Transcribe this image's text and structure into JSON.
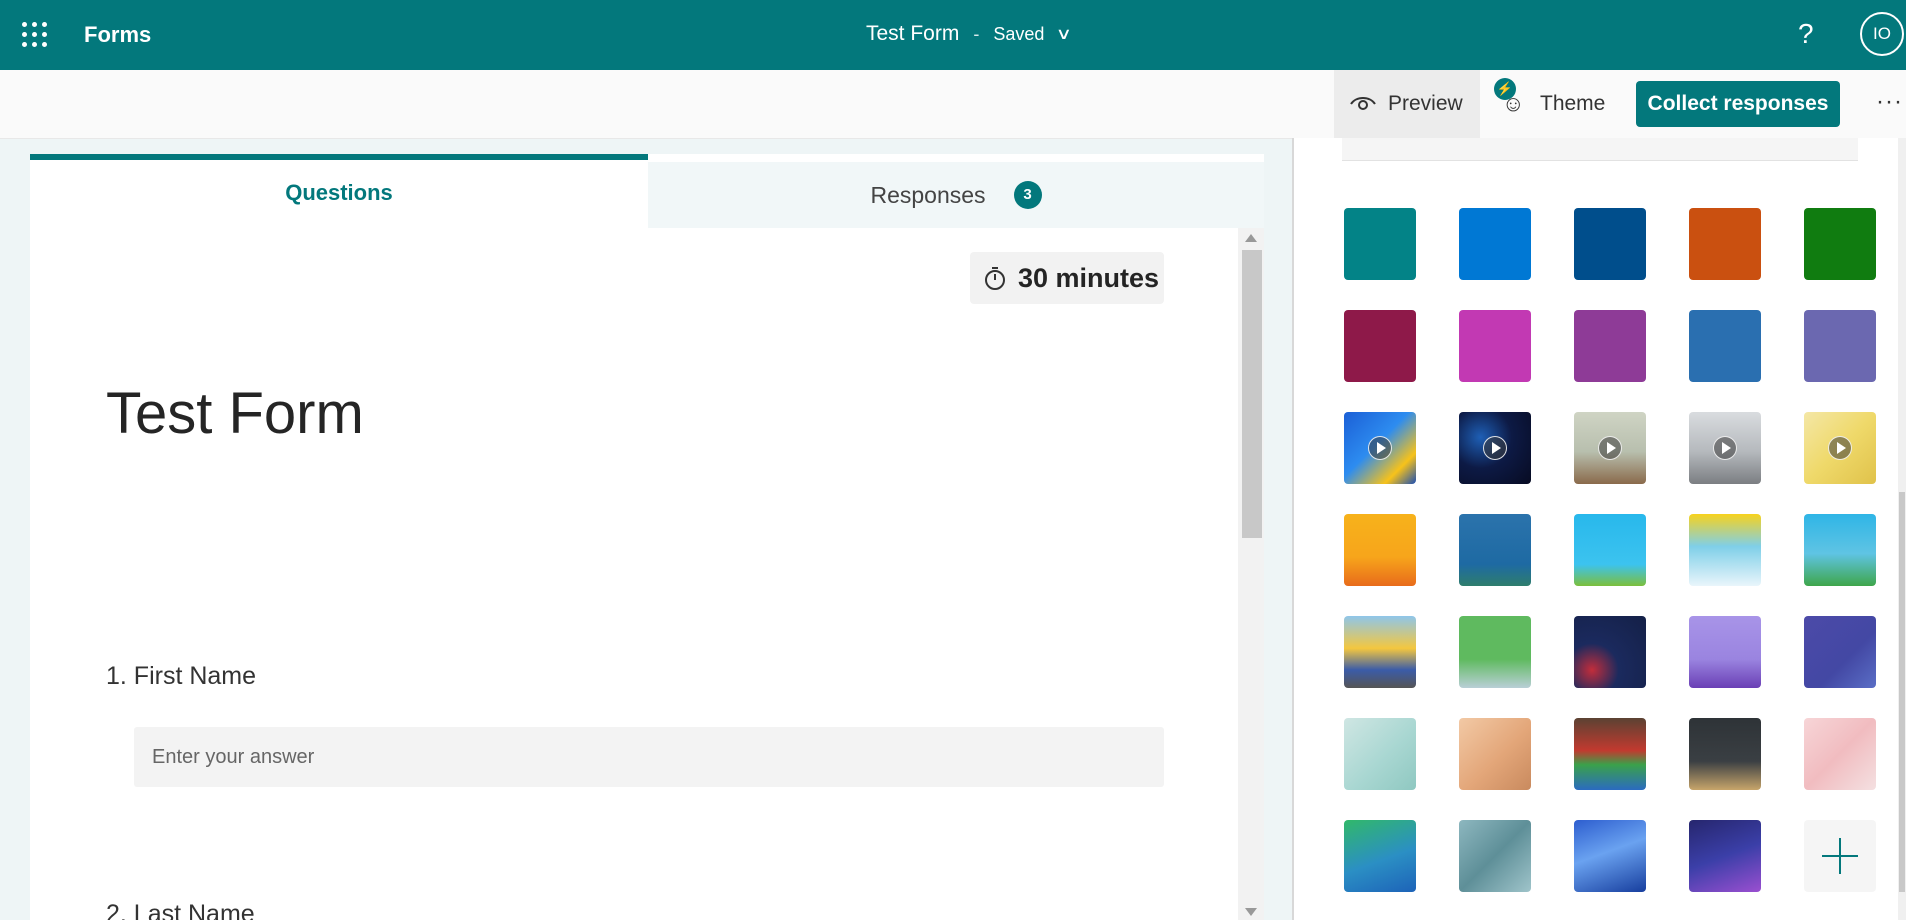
{
  "header": {
    "app_name": "Forms",
    "form_title": "Test Form",
    "separator": "-",
    "status": "Saved",
    "help_label": "?",
    "avatar_initials": "IO"
  },
  "commandbar": {
    "preview_label": "Preview",
    "theme_label": "Theme",
    "collect_label": "Collect responses",
    "more_label": "···"
  },
  "tabs": {
    "questions_label": "Questions",
    "responses_label": "Responses",
    "responses_count": "3"
  },
  "form": {
    "timer": "30 minutes",
    "title": "Test Form",
    "questions": [
      {
        "label": "1. First Name",
        "placeholder": "Enter your answer"
      },
      {
        "label": "2. Last Name"
      }
    ]
  },
  "theme_panel": {
    "swatches": [
      {
        "name": "teal",
        "style": "#038387"
      },
      {
        "name": "blue",
        "style": "#0078d4"
      },
      {
        "name": "dark-blue",
        "style": "#004e8c"
      },
      {
        "name": "orange",
        "style": "#ca5010"
      },
      {
        "name": "green",
        "style": "#107c10"
      },
      {
        "name": "burgundy",
        "style": "#8e1949"
      },
      {
        "name": "pink",
        "style": "#c239b3"
      },
      {
        "name": "purple",
        "style": "#8e3b97"
      },
      {
        "name": "steel-blue",
        "style": "#2a6fb0"
      },
      {
        "name": "lavender",
        "style": "#6b68b0"
      },
      {
        "name": "video-blue-shapes",
        "style": "linear-gradient(135deg,#1b5fd6 0%,#2d8cf0 45%,#f7c21a 78%,#1c4fb4 100%)",
        "video": true
      },
      {
        "name": "video-night-confetti",
        "style": "radial-gradient(circle at 30% 35%,#1e5fb5 0,#0d1a45 45%,#070b22 100%)",
        "video": true
      },
      {
        "name": "video-room",
        "style": "linear-gradient(180deg,#cfd4c4 0%,#b8bfae 55%,#8a6a4b 100%)",
        "video": true
      },
      {
        "name": "video-office",
        "style": "linear-gradient(180deg,#d9dcdf 0%,#b5b9bd 55%,#7b7e82 100%)",
        "video": true
      },
      {
        "name": "video-gold-shapes",
        "style": "linear-gradient(135deg,#f4e7a6 0%,#efd96a 50%,#e0c24a 100%)",
        "video": true
      },
      {
        "name": "yellow-orange-scene",
        "style": "linear-gradient(180deg,#f7b21b 0%,#f7a51b 60%,#e86b1b 100%)"
      },
      {
        "name": "blue-city-night",
        "style": "linear-gradient(180deg,#2b73ac 0%,#1e6aa3 70%,#2e7d6c 100%)"
      },
      {
        "name": "sky-clouds",
        "style": "linear-gradient(180deg,#28b8ec 0%,#3cc3ef 70%,#7cbf3c 100%)"
      },
      {
        "name": "snow-scene",
        "style": "linear-gradient(180deg,#f7d21d 0%,#7fcfe8 45%,#e9f5fb 100%)"
      },
      {
        "name": "green-city",
        "style": "linear-gradient(180deg,#2fb5e6 0%,#5fc4e4 55%,#3fa64b 100%)"
      },
      {
        "name": "buildings",
        "style": "linear-gradient(180deg,#8fc6ea 0%,#f4c73f 45%,#3b5ca8 75%,#555 100%)"
      },
      {
        "name": "green-shelf",
        "style": "linear-gradient(180deg,#5fba5f 0%,#5fba5f 60%,#b9cfd6 100%)"
      },
      {
        "name": "navy-abstract",
        "style": "radial-gradient(circle at 25% 75%,#c22d3b 0,#1b2a5e 35%,#142047 100%)"
      },
      {
        "name": "violet-room",
        "style": "linear-gradient(180deg,#a894e8 0%,#9a84e0 60%,#6a3fb5 100%)"
      },
      {
        "name": "indigo-papers",
        "style": "linear-gradient(135deg,#4c4aa8 0%,#4348a4 60%,#5a6ec6 100%)"
      },
      {
        "name": "desk-mint",
        "style": "linear-gradient(135deg,#cfe6e3 0%,#a9d7d2 55%,#8fc8c1 100%)"
      },
      {
        "name": "peach-desk",
        "style": "linear-gradient(135deg,#f2c9a5 0%,#e3a679 55%,#c98a5e 100%)"
      },
      {
        "name": "colored-pencils",
        "style": "linear-gradient(180deg,#5b4233 0%,#c23a2f 45%,#3aa14a 65%,#2b6bc0 100%)"
      },
      {
        "name": "dark-desk",
        "style": "linear-gradient(180deg,#2e3337 0%,#3a3f43 60%,#c7a56a 100%)"
      },
      {
        "name": "pink-marble",
        "style": "linear-gradient(135deg,#f7d5d7 0%,#f1bcc0 50%,#f4e0e1 100%)"
      },
      {
        "name": "green-blue-gradient",
        "style": "linear-gradient(160deg,#31b86a 0%,#2b8fc4 55%,#1d63b8 100%)"
      },
      {
        "name": "teal-ribbons",
        "style": "linear-gradient(135deg,#8db7bf 0%,#5e8f98 50%,#9fc4ca 100%)"
      },
      {
        "name": "blue-waves",
        "style": "linear-gradient(160deg,#2d5ecf 0%,#6aa2f0 45%,#173e9e 100%)"
      },
      {
        "name": "deep-purple",
        "style": "linear-gradient(160deg,#26266e 0%,#3b3fa8 50%,#9a4fd0 100%)"
      },
      {
        "name": "add-custom",
        "style": "",
        "add": true
      }
    ]
  },
  "colors": {
    "brand": "#03787c",
    "brand_dark": "#03787c"
  }
}
